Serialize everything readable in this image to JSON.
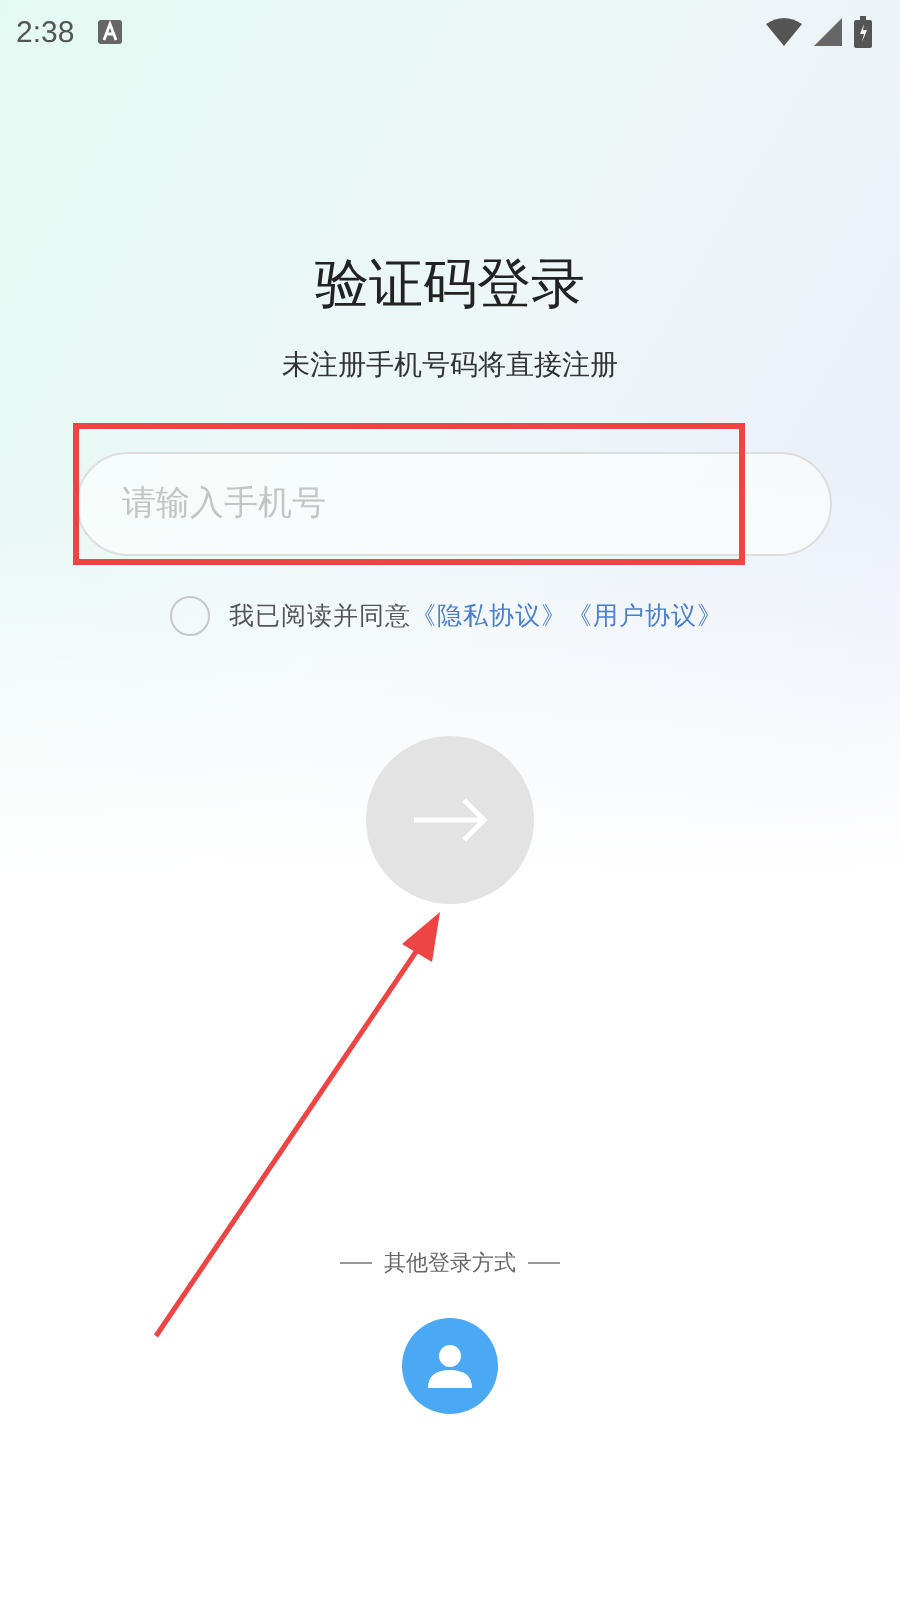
{
  "status_bar": {
    "time": "2:38"
  },
  "title": "验证码登录",
  "subtitle": "未注册手机号码将直接注册",
  "phone_field": {
    "placeholder": "请输入手机号"
  },
  "agreement": {
    "checked": false,
    "text": "我已阅读并同意",
    "links": [
      "《隐私协议》",
      "《用户协议》"
    ]
  },
  "next_button": {
    "disabled": true
  },
  "other_login": {
    "label": "其他登录方式"
  }
}
